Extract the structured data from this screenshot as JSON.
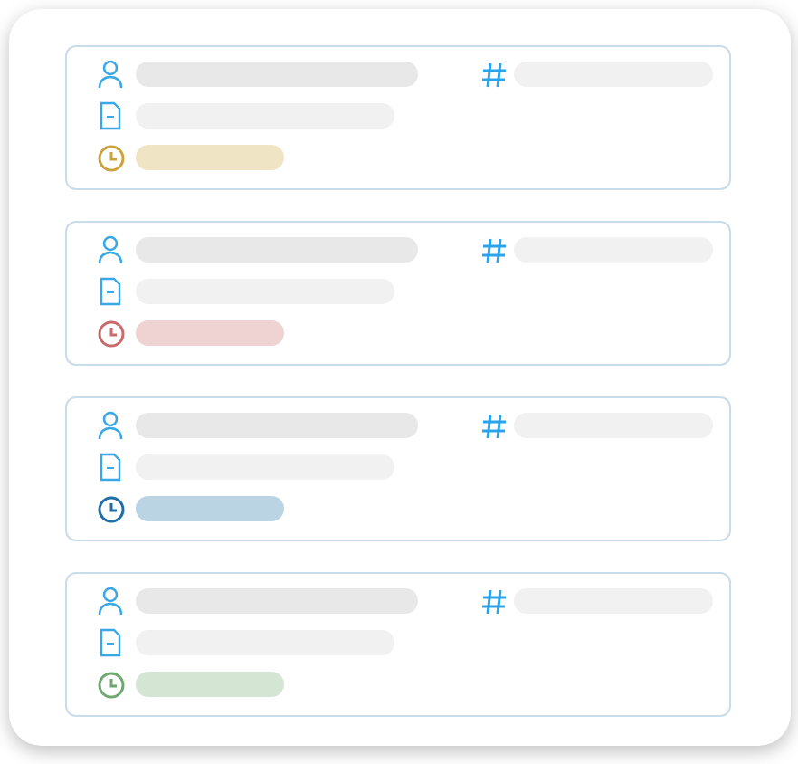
{
  "cards": [
    {
      "color": "#c9a43c"
    },
    {
      "color": "#c96b6b"
    },
    {
      "color": "#1f6fa6"
    },
    {
      "color": "#6fa86f"
    }
  ]
}
